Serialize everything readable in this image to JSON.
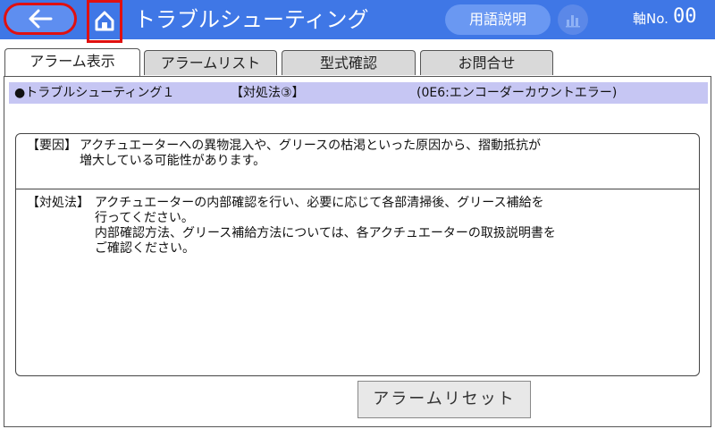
{
  "header": {
    "title": "トラブルシューティング",
    "term_button": "用語説明",
    "axis_label": "軸No.",
    "axis_value": "00",
    "colors": {
      "bar": "#3f77e6",
      "highlight": "#e01010"
    },
    "icons": [
      "arrow-left-icon",
      "home-icon",
      "bar-chart-icon"
    ]
  },
  "tabs": [
    {
      "label": "アラーム表示",
      "active": true
    },
    {
      "label": "アラームリスト",
      "active": false
    },
    {
      "label": "型式確認",
      "active": false
    },
    {
      "label": "お問合せ",
      "active": false
    }
  ],
  "strip": {
    "title": "●トラブルシューティング１",
    "method": "【対処法③】",
    "code": "(0E6:エンコーダーカウントエラー)"
  },
  "cause": {
    "label": "【要因】",
    "lines": [
      "アクチュエーターへの異物混入や、グリースの枯渇といった原因から、摺動抵抗が",
      "増大している可能性があります。"
    ]
  },
  "action": {
    "label": "【対処法】",
    "lines": [
      "アクチュエーターの内部確認を行い、必要に応じて各部清掃後、グリース補給を",
      "行ってください。",
      "内部確認方法、グリース補給方法については、各アクチュエーターの取扱説明書を",
      "ご確認ください。"
    ]
  },
  "reset_button": "アラームリセット"
}
